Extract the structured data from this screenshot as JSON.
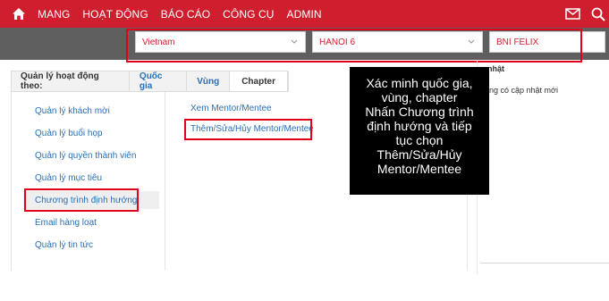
{
  "nav": {
    "items": [
      "MANG",
      "HOẠT ĐỘNG",
      "BÁO CÁO",
      "CÔNG CỤ",
      "ADMIN"
    ],
    "icons": [
      "home-icon",
      "mail-icon",
      "search-icon"
    ]
  },
  "filters": {
    "country": "Vietnam",
    "region": "HANOI 6",
    "chapter": "BNI FELIX"
  },
  "tabs": {
    "label": "Quản lý hoạt động theo:",
    "items": [
      "Quốc gia",
      "Vùng",
      "Chapter"
    ],
    "active": "Chapter"
  },
  "left_menu": {
    "items": [
      "Quản lý khách mời",
      "Quản lý buổi họp",
      "Quản lý quyền thành viên",
      "Quản lý mục tiêu",
      "Chương trình định hướng",
      "Email hàng loạt",
      "Quản lý tin tức"
    ],
    "active": "Chương trình định hướng"
  },
  "sub_menu": {
    "items": [
      "Xem Mentor/Mentee",
      "Thêm/Sửa/Hủy Mentor/Mentee"
    ]
  },
  "right_panel": {
    "title": "p nhật",
    "text": "hông có cập nhật mới"
  },
  "callout": {
    "lines": [
      "Xác minh quốc gia,",
      "vùng, chapter",
      "Nhấn Chương trình",
      "định hướng và tiếp",
      "tục chọn",
      "Thêm/Sửa/Hủy",
      "Mentor/Mentee"
    ]
  },
  "colors": {
    "brand_red": "#cf1f2e",
    "highlight_red": "#e2001a",
    "link_blue": "#2a6fb5",
    "filter_bar": "#5f5f5f"
  }
}
